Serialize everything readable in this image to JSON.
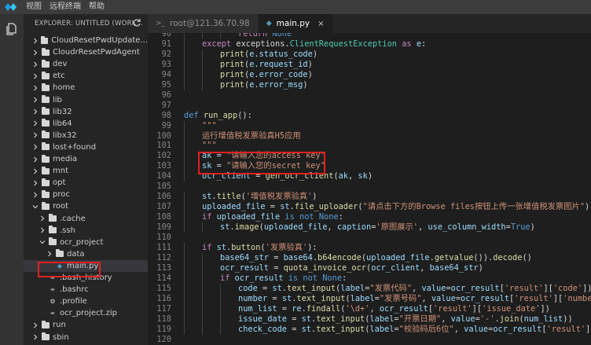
{
  "menubar": {
    "items": [
      "视图",
      "远程终端",
      "帮助"
    ]
  },
  "sidebar": {
    "title": "EXPLORER: UNTITLED (WORK...",
    "items": [
      {
        "label": "CloudResetPwdUpdate...",
        "kind": "folder",
        "expanded": false,
        "depth": 0
      },
      {
        "label": "CloudrResetPwdAgent",
        "kind": "folder",
        "expanded": false,
        "depth": 0
      },
      {
        "label": "dev",
        "kind": "folder",
        "expanded": false,
        "depth": 0
      },
      {
        "label": "etc",
        "kind": "folder",
        "expanded": false,
        "depth": 0
      },
      {
        "label": "home",
        "kind": "folder",
        "expanded": false,
        "depth": 0
      },
      {
        "label": "lib",
        "kind": "folder",
        "expanded": false,
        "depth": 0
      },
      {
        "label": "lib32",
        "kind": "folder",
        "expanded": false,
        "depth": 0
      },
      {
        "label": "lib64",
        "kind": "folder",
        "expanded": false,
        "depth": 0
      },
      {
        "label": "libx32",
        "kind": "folder",
        "expanded": false,
        "depth": 0
      },
      {
        "label": "lost+found",
        "kind": "folder",
        "expanded": false,
        "depth": 0
      },
      {
        "label": "media",
        "kind": "folder",
        "expanded": false,
        "depth": 0
      },
      {
        "label": "mnt",
        "kind": "folder",
        "expanded": false,
        "depth": 0
      },
      {
        "label": "opt",
        "kind": "folder",
        "expanded": false,
        "depth": 0
      },
      {
        "label": "proc",
        "kind": "folder",
        "expanded": false,
        "depth": 0
      },
      {
        "label": "root",
        "kind": "folder",
        "expanded": true,
        "depth": 0
      },
      {
        "label": ".cache",
        "kind": "folder",
        "expanded": false,
        "depth": 1
      },
      {
        "label": ".ssh",
        "kind": "folder",
        "expanded": false,
        "depth": 1
      },
      {
        "label": "ocr_project",
        "kind": "folder",
        "expanded": true,
        "depth": 1
      },
      {
        "label": "data",
        "kind": "folder",
        "expanded": false,
        "depth": 2
      },
      {
        "label": "main.py",
        "kind": "python",
        "depth": 2,
        "selected": true
      },
      {
        "label": ".bash_history",
        "kind": "file",
        "depth": 1
      },
      {
        "label": ".bashrc",
        "kind": "file",
        "depth": 1
      },
      {
        "label": ".profile",
        "kind": "gear",
        "depth": 1
      },
      {
        "label": "ocr_project.zip",
        "kind": "file",
        "depth": 1
      },
      {
        "label": "run",
        "kind": "folder",
        "expanded": false,
        "depth": 0
      },
      {
        "label": "sbin",
        "kind": "folder",
        "expanded": false,
        "depth": 0
      }
    ]
  },
  "tabs": [
    {
      "label": "root@121.36.70.98",
      "icon": "terminal-icon",
      "active": false
    },
    {
      "label": "main.py",
      "icon": "python-icon",
      "active": true,
      "close": "×"
    }
  ],
  "editor": {
    "lines": [
      {
        "n": "90",
        "indent": 3,
        "tokens": [
          [
            "kw2",
            "return"
          ],
          [
            "",
            " "
          ],
          [
            "kw",
            "None"
          ]
        ]
      },
      {
        "n": "91",
        "indent": 1,
        "tokens": [
          [
            "kw2",
            "except"
          ],
          [
            "",
            " exceptions."
          ],
          [
            "cls",
            "ClientRequestException"
          ],
          [
            "",
            " "
          ],
          [
            "kw2",
            "as"
          ],
          [
            "",
            " "
          ],
          [
            "var",
            "e"
          ],
          [
            "",
            ":"
          ]
        ]
      },
      {
        "n": "92",
        "indent": 2,
        "tokens": [
          [
            "fn",
            "print"
          ],
          [
            "",
            "("
          ],
          [
            "var",
            "e"
          ],
          [
            "",
            "."
          ],
          [
            "var",
            "status_code"
          ],
          [
            "",
            ")"
          ]
        ]
      },
      {
        "n": "93",
        "indent": 2,
        "tokens": [
          [
            "fn",
            "print"
          ],
          [
            "",
            "("
          ],
          [
            "var",
            "e"
          ],
          [
            "",
            "."
          ],
          [
            "var",
            "request_id"
          ],
          [
            "",
            ")"
          ]
        ]
      },
      {
        "n": "94",
        "indent": 2,
        "tokens": [
          [
            "fn",
            "print"
          ],
          [
            "",
            "("
          ],
          [
            "var",
            "e"
          ],
          [
            "",
            "."
          ],
          [
            "var",
            "error_code"
          ],
          [
            "",
            ")"
          ]
        ]
      },
      {
        "n": "95",
        "indent": 2,
        "tokens": [
          [
            "fn",
            "print"
          ],
          [
            "",
            "("
          ],
          [
            "var",
            "e"
          ],
          [
            "",
            "."
          ],
          [
            "var",
            "error_msg"
          ],
          [
            "",
            ")"
          ]
        ]
      },
      {
        "n": "96",
        "indent": 0,
        "tokens": []
      },
      {
        "n": "97",
        "indent": 0,
        "tokens": []
      },
      {
        "n": "98",
        "indent": 0,
        "tokens": [
          [
            "kw",
            "def"
          ],
          [
            "",
            " "
          ],
          [
            "fn",
            "run_app"
          ],
          [
            "",
            "():"
          ]
        ]
      },
      {
        "n": "99",
        "indent": 1,
        "tokens": [
          [
            "str",
            "\"\"\""
          ]
        ]
      },
      {
        "n": "100",
        "indent": 1,
        "tokens": [
          [
            "str",
            "运行增值税发票验真H5应用"
          ]
        ]
      },
      {
        "n": "101",
        "indent": 1,
        "tokens": [
          [
            "str",
            "\"\"\""
          ]
        ]
      },
      {
        "n": "102",
        "indent": 1,
        "tokens": [
          [
            "var",
            "ak"
          ],
          [
            "",
            " = "
          ],
          [
            "str",
            "\"请输入您的access key\""
          ]
        ]
      },
      {
        "n": "103",
        "indent": 1,
        "tokens": [
          [
            "var",
            "sk"
          ],
          [
            "",
            " = "
          ],
          [
            "str",
            "\"请输入您的secret key\""
          ]
        ]
      },
      {
        "n": "104",
        "indent": 1,
        "tokens": [
          [
            "var",
            "ocr_client"
          ],
          [
            "",
            " = "
          ],
          [
            "fn",
            "gen_ocr_client"
          ],
          [
            "",
            "("
          ],
          [
            "var",
            "ak"
          ],
          [
            "",
            ", "
          ],
          [
            "var",
            "sk"
          ],
          [
            "",
            ")"
          ]
        ]
      },
      {
        "n": "105",
        "indent": 0,
        "tokens": []
      },
      {
        "n": "106",
        "indent": 1,
        "tokens": [
          [
            "var",
            "st"
          ],
          [
            "",
            "."
          ],
          [
            "fn",
            "title"
          ],
          [
            "",
            "("
          ],
          [
            "str",
            "'增值税发票验真'"
          ],
          [
            "",
            ")"
          ]
        ]
      },
      {
        "n": "107",
        "indent": 1,
        "tokens": [
          [
            "var",
            "uploaded_file"
          ],
          [
            "",
            " = "
          ],
          [
            "var",
            "st"
          ],
          [
            "",
            "."
          ],
          [
            "fn",
            "file_uploader"
          ],
          [
            "",
            "("
          ],
          [
            "str",
            "\"请点击下方的Browse files按钮上传一张增值税发票图片\""
          ],
          [
            "",
            ")"
          ]
        ]
      },
      {
        "n": "108",
        "indent": 1,
        "tokens": [
          [
            "kw2",
            "if"
          ],
          [
            "",
            " "
          ],
          [
            "var",
            "uploaded_file"
          ],
          [
            "",
            " "
          ],
          [
            "kw",
            "is not"
          ],
          [
            "",
            " "
          ],
          [
            "kw",
            "None"
          ],
          [
            "",
            ":"
          ]
        ]
      },
      {
        "n": "109",
        "indent": 2,
        "tokens": [
          [
            "var",
            "st"
          ],
          [
            "",
            "."
          ],
          [
            "fn",
            "image"
          ],
          [
            "",
            "("
          ],
          [
            "var",
            "uploaded_file"
          ],
          [
            "",
            ", "
          ],
          [
            "var",
            "caption"
          ],
          [
            "",
            "="
          ],
          [
            "str",
            "'原图展示'"
          ],
          [
            "",
            ", "
          ],
          [
            "var",
            "use_column_width"
          ],
          [
            "",
            "="
          ],
          [
            "kw",
            "True"
          ],
          [
            "",
            ")"
          ]
        ]
      },
      {
        "n": "110",
        "indent": 0,
        "tokens": []
      },
      {
        "n": "111",
        "indent": 1,
        "tokens": [
          [
            "kw2",
            "if"
          ],
          [
            "",
            " "
          ],
          [
            "var",
            "st"
          ],
          [
            "",
            "."
          ],
          [
            "fn",
            "button"
          ],
          [
            "",
            "("
          ],
          [
            "str",
            "'发票验真'"
          ],
          [
            "",
            "):"
          ]
        ]
      },
      {
        "n": "112",
        "indent": 2,
        "tokens": [
          [
            "var",
            "base64_str"
          ],
          [
            "",
            " = "
          ],
          [
            "var",
            "base64"
          ],
          [
            "",
            "."
          ],
          [
            "fn",
            "b64encode"
          ],
          [
            "",
            "("
          ],
          [
            "var",
            "uploaded_file"
          ],
          [
            "",
            "."
          ],
          [
            "fn",
            "getvalue"
          ],
          [
            "",
            "())."
          ],
          [
            "fn",
            "decode"
          ],
          [
            "",
            "()"
          ]
        ]
      },
      {
        "n": "113",
        "indent": 2,
        "tokens": [
          [
            "var",
            "ocr_result"
          ],
          [
            "",
            " = "
          ],
          [
            "fn",
            "quota_invoice_ocr"
          ],
          [
            "",
            "("
          ],
          [
            "var",
            "ocr_client"
          ],
          [
            "",
            ", "
          ],
          [
            "var",
            "base64_str"
          ],
          [
            "",
            ")"
          ]
        ]
      },
      {
        "n": "114",
        "indent": 2,
        "tokens": [
          [
            "kw2",
            "if"
          ],
          [
            "",
            " "
          ],
          [
            "var",
            "ocr_result"
          ],
          [
            "",
            " "
          ],
          [
            "kw",
            "is not"
          ],
          [
            "",
            " "
          ],
          [
            "kw",
            "None"
          ],
          [
            "",
            ":"
          ]
        ]
      },
      {
        "n": "115",
        "indent": 3,
        "tokens": [
          [
            "var",
            "code"
          ],
          [
            "",
            " = "
          ],
          [
            "var",
            "st"
          ],
          [
            "",
            "."
          ],
          [
            "fn",
            "text_input"
          ],
          [
            "",
            "("
          ],
          [
            "var",
            "label"
          ],
          [
            "",
            "="
          ],
          [
            "str",
            "\"发票代码\""
          ],
          [
            "",
            ", "
          ],
          [
            "var",
            "value"
          ],
          [
            "",
            "="
          ],
          [
            "var",
            "ocr_result"
          ],
          [
            "",
            "["
          ],
          [
            "str",
            "'result'"
          ],
          [
            "",
            "]["
          ],
          [
            "str",
            "'code'"
          ],
          [
            "",
            "])"
          ]
        ]
      },
      {
        "n": "116",
        "indent": 3,
        "tokens": [
          [
            "var",
            "number"
          ],
          [
            "",
            " = "
          ],
          [
            "var",
            "st"
          ],
          [
            "",
            "."
          ],
          [
            "fn",
            "text_input"
          ],
          [
            "",
            "("
          ],
          [
            "var",
            "label"
          ],
          [
            "",
            "="
          ],
          [
            "str",
            "\"发票号码\""
          ],
          [
            "",
            ", "
          ],
          [
            "var",
            "value"
          ],
          [
            "",
            "="
          ],
          [
            "var",
            "ocr_result"
          ],
          [
            "",
            "["
          ],
          [
            "str",
            "'result'"
          ],
          [
            "",
            "]["
          ],
          [
            "str",
            "'number'"
          ],
          [
            "",
            "])"
          ]
        ]
      },
      {
        "n": "117",
        "indent": 3,
        "tokens": [
          [
            "var",
            "num_list"
          ],
          [
            "",
            " = "
          ],
          [
            "var",
            "re"
          ],
          [
            "",
            "."
          ],
          [
            "fn",
            "findall"
          ],
          [
            "",
            "("
          ],
          [
            "str",
            "'\\d+'"
          ],
          [
            "",
            ", "
          ],
          [
            "var",
            "ocr_result"
          ],
          [
            "",
            "["
          ],
          [
            "str",
            "'result'"
          ],
          [
            "",
            "]["
          ],
          [
            "str",
            "'issue_date'"
          ],
          [
            "",
            "])"
          ]
        ]
      },
      {
        "n": "118",
        "indent": 3,
        "tokens": [
          [
            "var",
            "issue_date"
          ],
          [
            "",
            " = "
          ],
          [
            "var",
            "st"
          ],
          [
            "",
            "."
          ],
          [
            "fn",
            "text_input"
          ],
          [
            "",
            "("
          ],
          [
            "var",
            "label"
          ],
          [
            "",
            "="
          ],
          [
            "str",
            "\"开票日期\""
          ],
          [
            "",
            ", "
          ],
          [
            "var",
            "value"
          ],
          [
            "",
            "="
          ],
          [
            "str",
            "'-'"
          ],
          [
            "",
            "."
          ],
          [
            "fn",
            "join"
          ],
          [
            "",
            "("
          ],
          [
            "var",
            "num_list"
          ],
          [
            "",
            "))"
          ]
        ]
      },
      {
        "n": "119",
        "indent": 3,
        "tokens": [
          [
            "var",
            "check_code"
          ],
          [
            "",
            " = "
          ],
          [
            "var",
            "st"
          ],
          [
            "",
            "."
          ],
          [
            "fn",
            "text_input"
          ],
          [
            "",
            "("
          ],
          [
            "var",
            "label"
          ],
          [
            "",
            "="
          ],
          [
            "str",
            "\"校验码后6位\""
          ],
          [
            "",
            ", "
          ],
          [
            "var",
            "value"
          ],
          [
            "",
            "="
          ],
          [
            "var",
            "ocr_result"
          ],
          [
            "",
            "["
          ],
          [
            "str",
            "'result'"
          ],
          [
            "",
            "]["
          ],
          [
            "str",
            "'che"
          ]
        ]
      },
      {
        "n": "120",
        "indent": 0,
        "tokens": []
      }
    ]
  },
  "colors": {
    "highlight": "#e02020",
    "accent": "#007acc"
  }
}
